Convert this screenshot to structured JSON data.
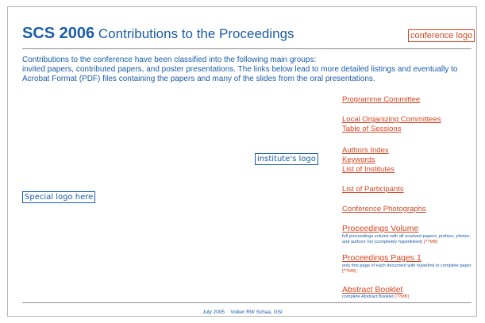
{
  "header": {
    "title_bold": "SCS 2006",
    "title_rest": "Contributions to the Proceedings",
    "conference_logo": "conference logo"
  },
  "intro": {
    "line1": "Contributions to the conference have been classified into the following main groups:",
    "line2": "invited papers, contributed papers, and poster presentations. The links below lead to more detailed listings and eventually to Acrobat Format (PDF) files containing the papers and many of the slides from the oral presentations."
  },
  "logos": {
    "special": "Special logo here",
    "institute": "institute's logo"
  },
  "links": {
    "programme_committee": "Programme Committee",
    "local_organizing": "Local Organizing Committees",
    "table_of_sessions": "Table of Sessions",
    "authors_index": "Authors Index",
    "keywords": "Keywords",
    "list_of_institutes": "List of Institutes",
    "list_of_participants": "List of Participants",
    "conference_photographs": "Conference Photographs",
    "proceedings_volume": {
      "label": "Proceedings Volume",
      "desc": "full proceedings volume with all received papers, preface, photos, and authors' list (completely hyperlinked)",
      "size": "[??MB]"
    },
    "proceedings_pages": {
      "label": "Proceedings Pages 1",
      "desc": "only first page of each document with  hyperlink to complete paper",
      "size": "[??MB]"
    },
    "abstract_booklet": {
      "label": "Abstract Booklet",
      "desc": "complete Abstract Booklet",
      "size": "[??MB]"
    }
  },
  "footer": {
    "date": "July 2005",
    "author": "Volker RW Schaa, GSI"
  },
  "colors": {
    "text_blue": "#1a5ca8",
    "link_red": "#d64420",
    "rule_gray": "#8a8a8a"
  }
}
